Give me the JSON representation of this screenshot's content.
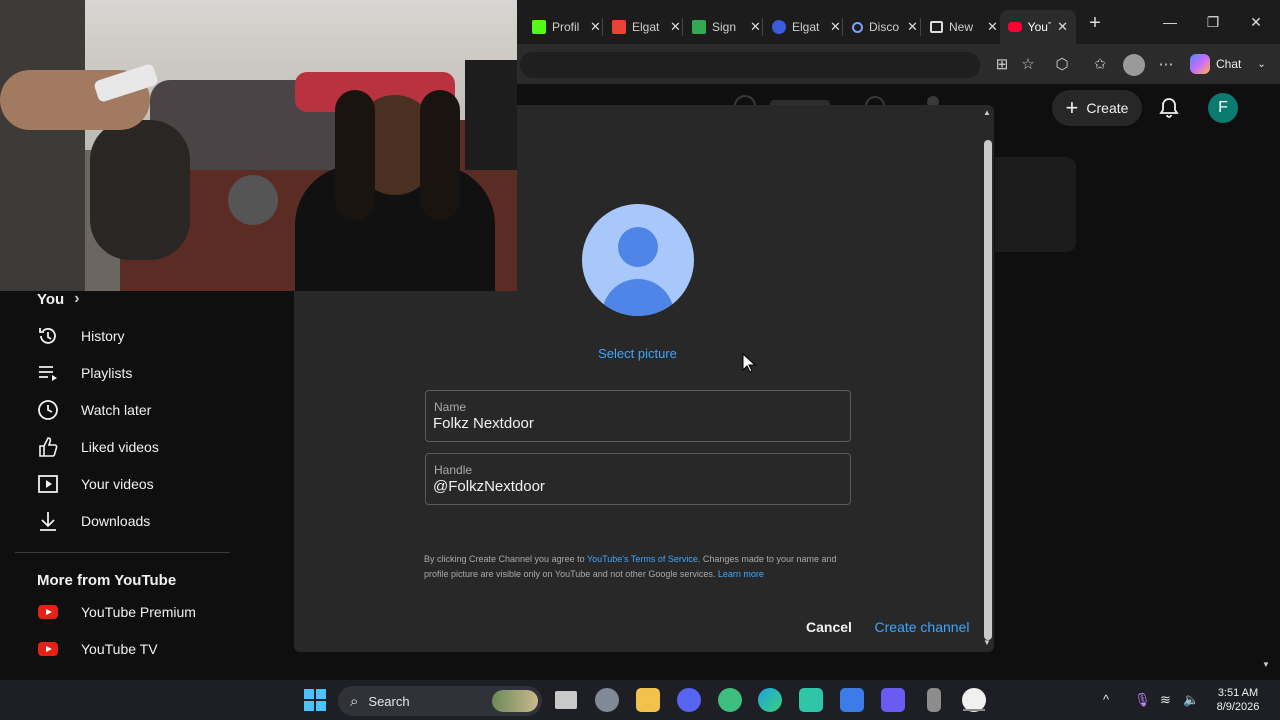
{
  "browser": {
    "tabs": [
      {
        "label": "Profil",
        "icon": "kick-icon",
        "color": "#53fc18"
      },
      {
        "label": "Elgat",
        "icon": "gmail-icon",
        "color": "#ea4335"
      },
      {
        "label": "Sign",
        "icon": "signup-icon",
        "color": "#34a853"
      },
      {
        "label": "Elgat",
        "icon": "elgato-icon",
        "color": "#3b5bdb"
      },
      {
        "label": "Disco",
        "icon": "search-icon",
        "color": "#7aa2ff"
      },
      {
        "label": "New",
        "icon": "newtab-icon",
        "color": "#dddddd"
      },
      {
        "label": "YouT",
        "icon": "youtube-icon",
        "color": "#ff0033"
      }
    ],
    "chat_label": "Chat"
  },
  "youtube": {
    "create_label": "Create",
    "avatar_letter": "F",
    "sidebar": {
      "you_heading": "You",
      "you_chevron": "›",
      "items": [
        {
          "label": "History",
          "icon": "history-icon"
        },
        {
          "label": "Playlists",
          "icon": "playlists-icon"
        },
        {
          "label": "Watch later",
          "icon": "watch-later-icon"
        },
        {
          "label": "Liked videos",
          "icon": "thumbs-up-icon"
        },
        {
          "label": "Your videos",
          "icon": "your-videos-icon"
        },
        {
          "label": "Downloads",
          "icon": "download-icon"
        }
      ],
      "more_heading": "More from YouTube",
      "more_items": [
        {
          "label": "YouTube Premium",
          "icon": "youtube-premium-icon"
        },
        {
          "label": "YouTube TV",
          "icon": "youtube-tv-icon"
        }
      ]
    }
  },
  "dialog": {
    "select_picture": "Select picture",
    "name_label": "Name",
    "name_value": "Folkz Nextdoor",
    "handle_label": "Handle",
    "handle_value": "@FolkzNextdoor",
    "legal_pre": "By clicking Create Channel you agree to ",
    "legal_tos": "YouTube's Terms of Service",
    "legal_post": ". Changes made to your name and profile picture are visible only on YouTube and not other Google services. ",
    "legal_learn": "Learn more",
    "cancel_label": "Cancel",
    "create_label": "Create channel"
  },
  "taskbar": {
    "search_label": "Search",
    "time": "3:51 AM",
    "date": "8/9/2026"
  }
}
